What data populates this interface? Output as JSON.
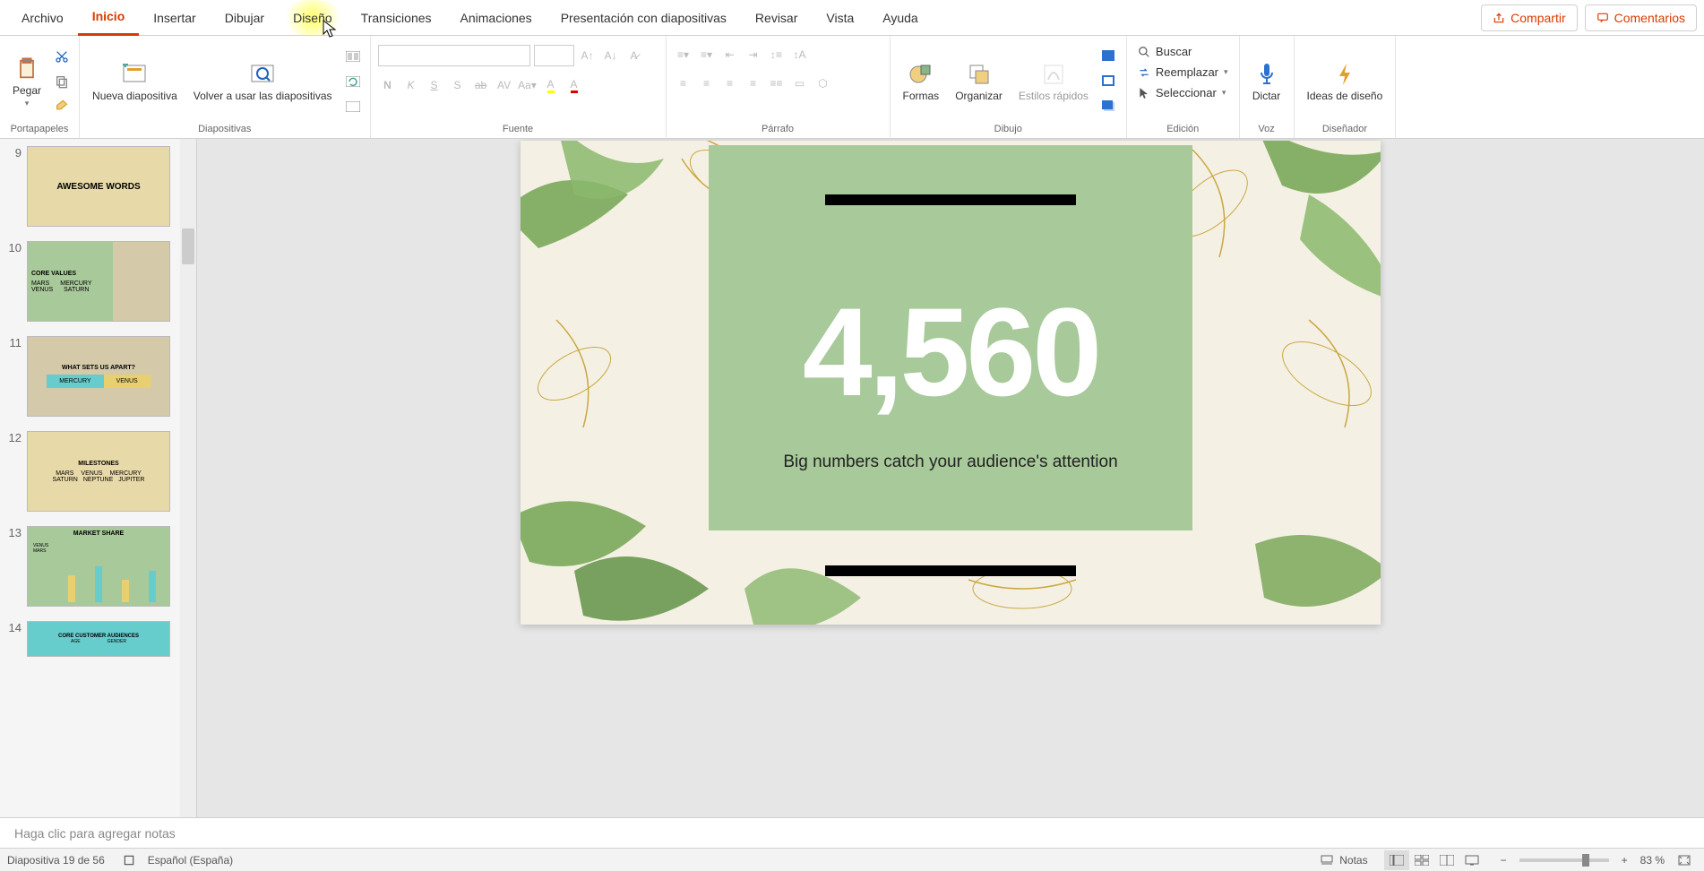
{
  "tabs": {
    "archivo": "Archivo",
    "inicio": "Inicio",
    "insertar": "Insertar",
    "dibujar": "Dibujar",
    "diseno": "Diseño",
    "transiciones": "Transiciones",
    "animaciones": "Animaciones",
    "presentacion": "Presentación con diapositivas",
    "revisar": "Revisar",
    "vista": "Vista",
    "ayuda": "Ayuda"
  },
  "header_buttons": {
    "compartir": "Compartir",
    "comentarios": "Comentarios"
  },
  "ribbon": {
    "portapapeles": {
      "label": "Portapapeles",
      "pegar": "Pegar"
    },
    "diapositivas": {
      "label": "Diapositivas",
      "nueva": "Nueva diapositiva",
      "volver": "Volver a usar las diapositivas"
    },
    "fuente": {
      "label": "Fuente"
    },
    "parrafo": {
      "label": "Párrafo"
    },
    "dibujo": {
      "label": "Dibujo",
      "formas": "Formas",
      "organizar": "Organizar",
      "estilos": "Estilos rápidos"
    },
    "edicion": {
      "label": "Edición",
      "buscar": "Buscar",
      "reemplazar": "Reemplazar",
      "seleccionar": "Seleccionar"
    },
    "voz": {
      "label": "Voz",
      "dictar": "Dictar"
    },
    "disenador": {
      "label": "Diseñador",
      "ideas": "Ideas de diseño"
    }
  },
  "thumbs": {
    "s9": {
      "num": "9",
      "title": "AWESOME WORDS"
    },
    "s10": {
      "num": "10",
      "title": "CORE VALUES",
      "i1": "MARS",
      "i2": "MERCURY",
      "i3": "VENUS",
      "i4": "SATURN"
    },
    "s11": {
      "num": "11",
      "title": "WHAT SETS US APART?",
      "i1": "MERCURY",
      "i2": "VENUS"
    },
    "s12": {
      "num": "12",
      "title": "MILESTONES",
      "i1": "MARS",
      "i2": "VENUS",
      "i3": "MERCURY",
      "i4": "SATURN",
      "i5": "NEPTUNE",
      "i6": "JUPITER"
    },
    "s13": {
      "num": "13",
      "title": "MARKET SHARE",
      "i1": "VENUS",
      "i2": "MARS"
    },
    "s14": {
      "num": "14",
      "title": "CORE CUSTOMER AUDIENCES",
      "i1": "AGE",
      "i2": "GENDER"
    }
  },
  "slide": {
    "bignum": "4,560",
    "subtext": "Big numbers catch your audience's attention"
  },
  "notes": {
    "placeholder": "Haga clic para agregar notas"
  },
  "status": {
    "slide_counter": "Diapositiva 19 de 56",
    "language": "Español (España)",
    "notas": "Notas",
    "zoom": "83 %"
  }
}
